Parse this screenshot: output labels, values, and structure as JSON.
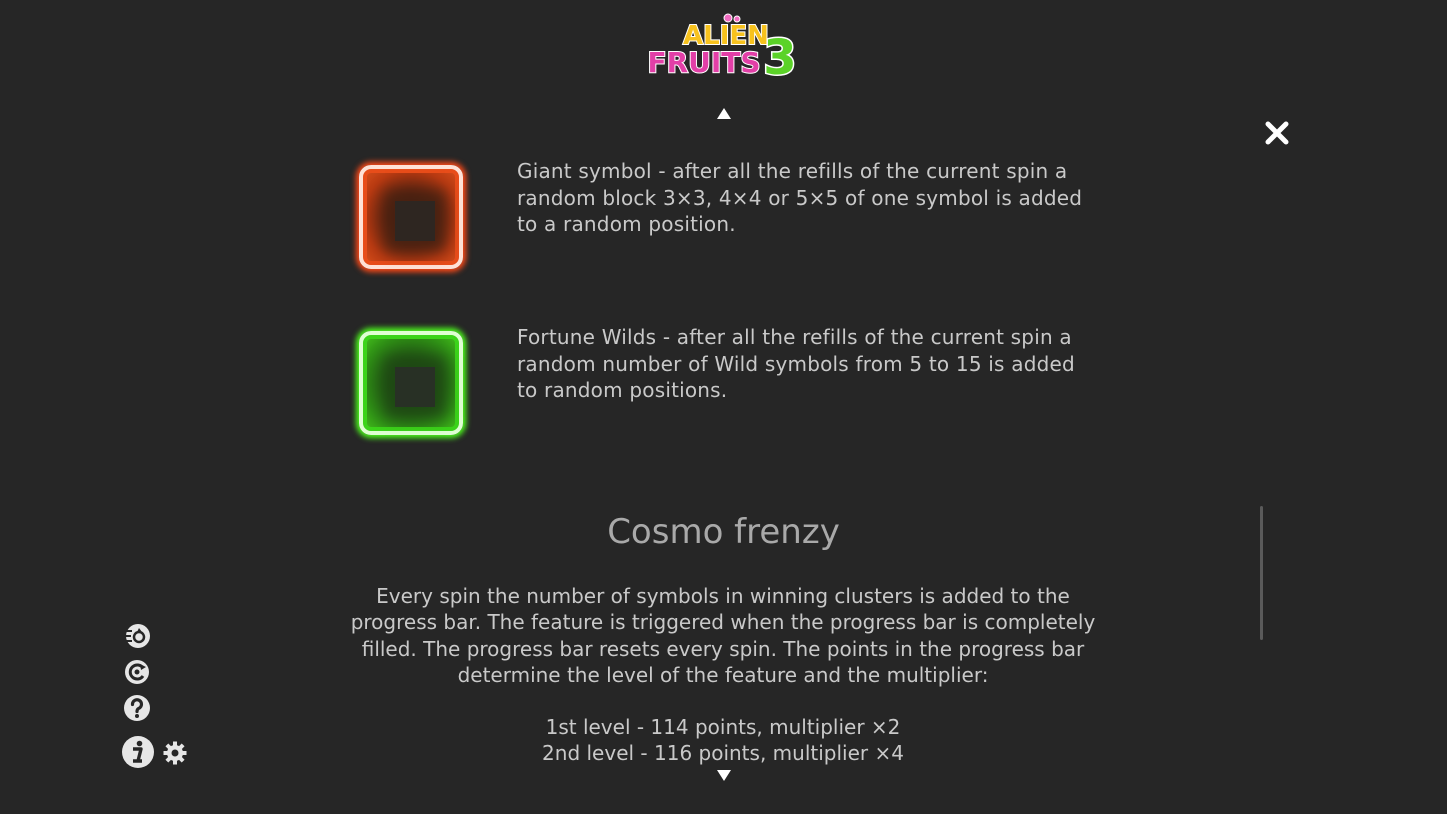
{
  "logo": {
    "line1": "ALIEN",
    "line2": "FRUITS",
    "number": "3"
  },
  "features": [
    {
      "icon": "red-glow-square",
      "color": "#e84d1a",
      "text": "Giant symbol - after all the refills of the current spin a random block 3×3, 4×4 or 5×5 of one symbol is added to a random position."
    },
    {
      "icon": "green-glow-square",
      "color": "#3cd41a",
      "text": "Fortune Wilds - after all the refills of the current spin a random number of Wild symbols from 5 to 15 is added to random positions."
    }
  ],
  "section": {
    "title": "Cosmo frenzy",
    "body": "Every spin the number of symbols in winning clusters is added to the progress bar. The feature is triggered when the progress bar is completely filled. The progress bar resets every spin. The points in the progress bar determine the level of the feature and the multiplier:",
    "levels": [
      "1st level - 114 points, multiplier ×2",
      "2nd level - 116 points, multiplier ×4"
    ]
  },
  "controls": {
    "icons": [
      "turbo-spin-icon",
      "autoplay-icon",
      "help-icon",
      "info-icon",
      "settings-icon",
      "close-icon",
      "scroll-up-icon",
      "scroll-down-icon"
    ]
  }
}
